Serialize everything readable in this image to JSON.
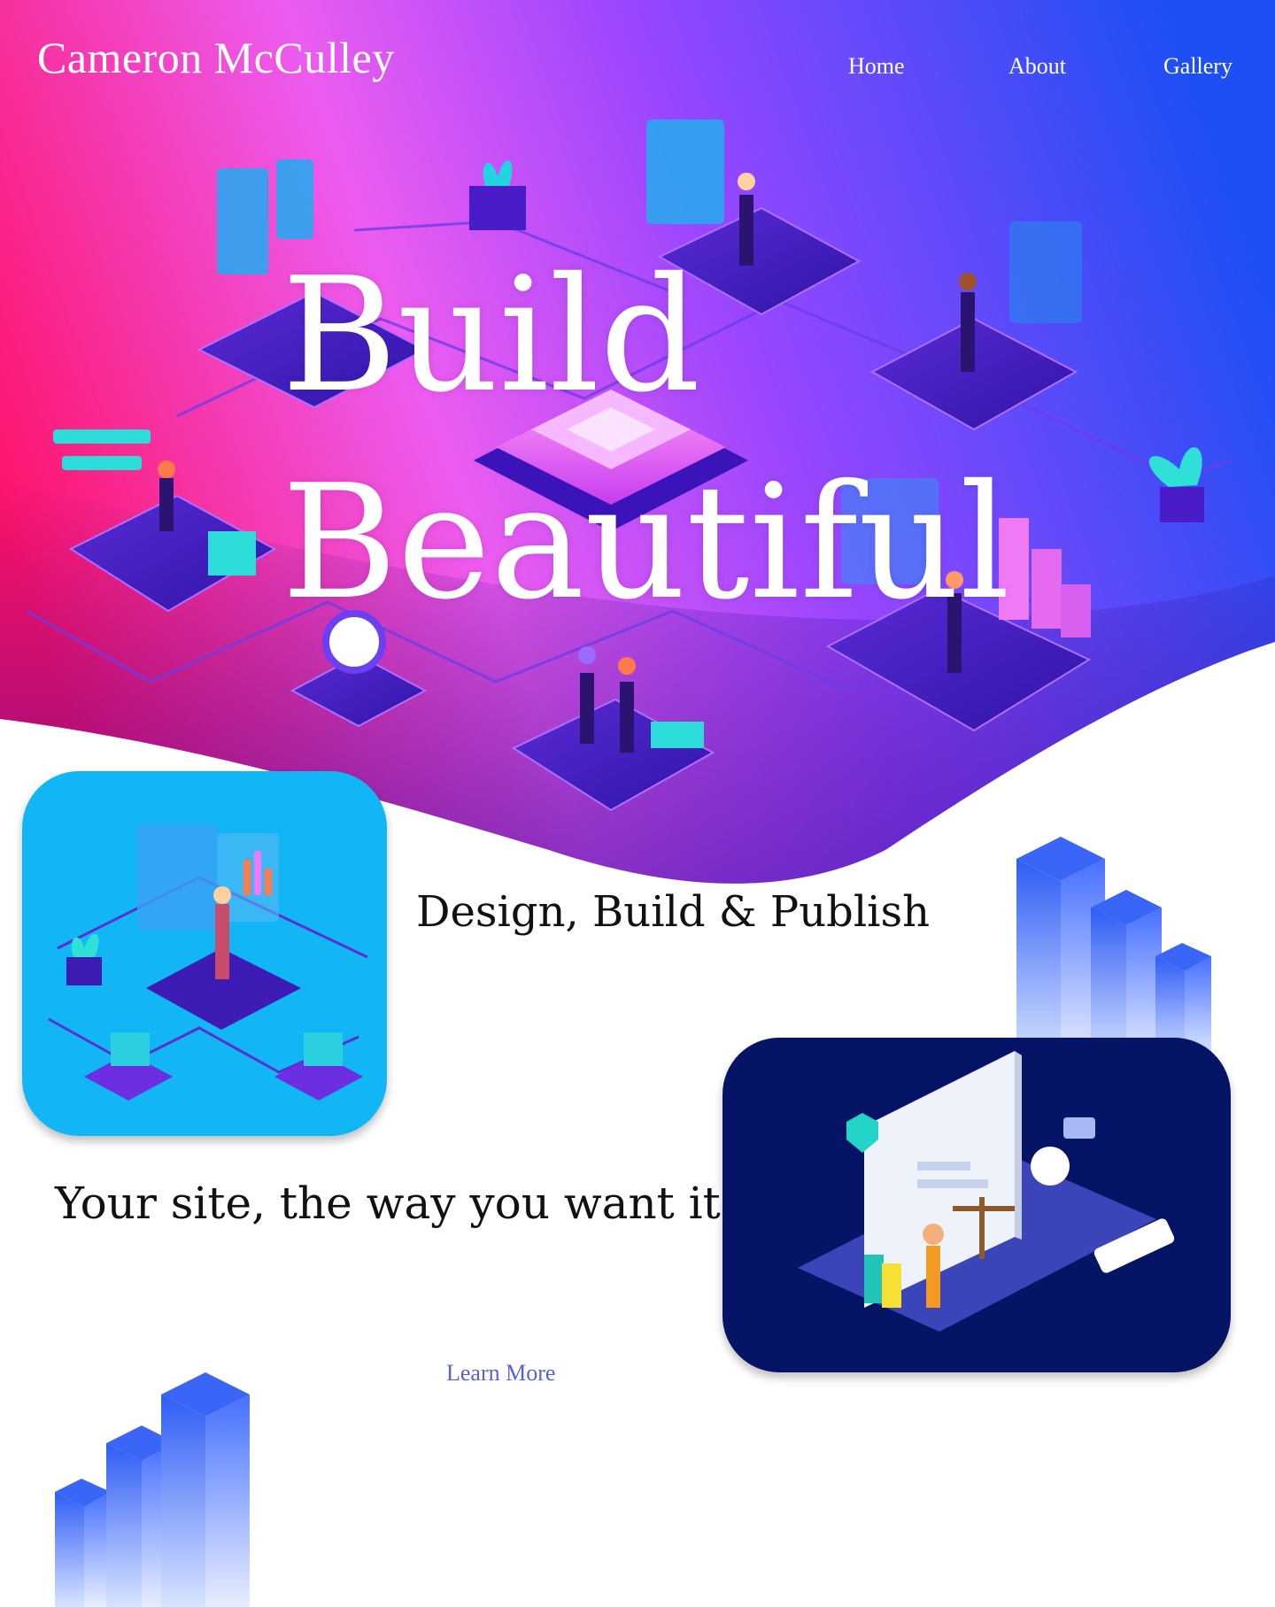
{
  "header": {
    "site_name": "Cameron McCulley",
    "nav": [
      "Home",
      "About",
      "Gallery"
    ]
  },
  "hero": {
    "title_line1": "Build",
    "title_line2": "Beautiful"
  },
  "sections": {
    "heading_1": "Design, Build & Publish",
    "heading_2": "Your site, the way you want it",
    "cta_label": "Learn More"
  },
  "colors": {
    "hero_gradient": [
      "#ff1a7a",
      "#f06cf2",
      "#8a3bff",
      "#1b55f5"
    ],
    "card_1_bg": "#12b6f5",
    "card_2_bg": "#061466",
    "link": "#5a60dc"
  }
}
